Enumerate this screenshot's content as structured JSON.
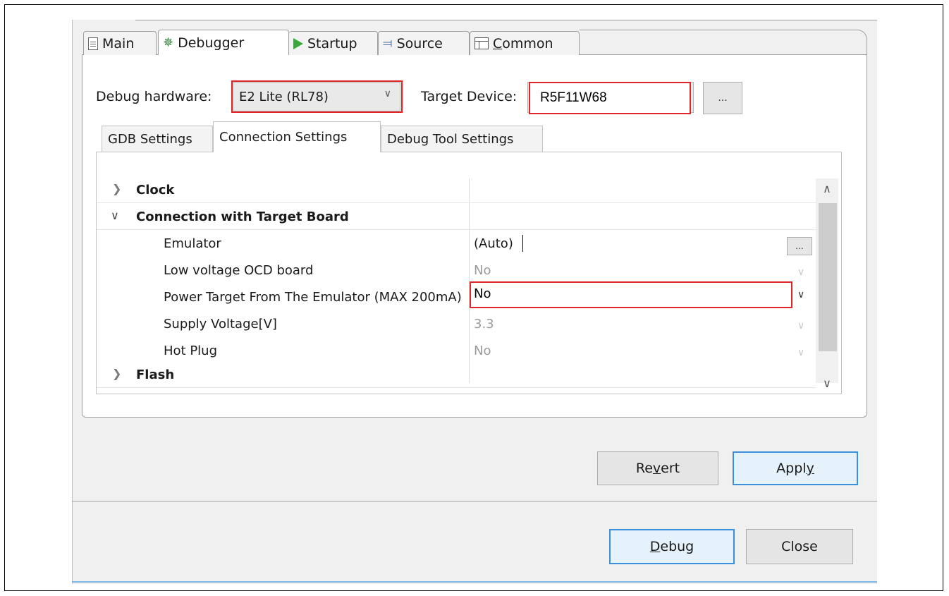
{
  "main_tabs": [
    {
      "label_pre": "Main",
      "label_u": "",
      "label_post": "",
      "icon": "document-icon",
      "active": false
    },
    {
      "label_pre": "Debugger",
      "label_u": "",
      "label_post": "",
      "icon": "bug-icon",
      "active": true
    },
    {
      "label_pre": "Startup",
      "label_u": "",
      "label_post": "",
      "icon": "play-icon",
      "active": false
    },
    {
      "label_pre": "Source",
      "label_u": "",
      "label_post": "",
      "icon": "source-icon",
      "active": false
    },
    {
      "label_pre": "",
      "label_u": "C",
      "label_post": "ommon",
      "icon": "table-icon",
      "active": false
    }
  ],
  "debug_hardware": {
    "label": "Debug hardware:",
    "value": "E2 Lite (RL78)"
  },
  "target_device": {
    "label": "Target Device:",
    "value": "R5F11W68",
    "browse_label": "..."
  },
  "sub_tabs": [
    {
      "label": "GDB Settings",
      "active": false
    },
    {
      "label": "Connection Settings",
      "active": true
    },
    {
      "label": "Debug Tool Settings",
      "active": false
    }
  ],
  "tree": {
    "clock": {
      "name": "Clock",
      "expanded": false
    },
    "connection": {
      "name": "Connection with Target Board",
      "expanded": true
    },
    "emulator": {
      "name": "Emulator",
      "value": "(Auto)",
      "button": "..."
    },
    "low_voltage": {
      "name": "Low voltage OCD board",
      "value": "No"
    },
    "power_target": {
      "name": "Power Target From The Emulator (MAX 200mA)",
      "value": "No"
    },
    "supply_voltage": {
      "name": "Supply Voltage[V]",
      "value": "3.3"
    },
    "hot_plug": {
      "name": "Hot Plug",
      "value": "No"
    },
    "flash": {
      "name": "Flash",
      "expanded": false
    }
  },
  "buttons": {
    "revert": {
      "pre": "Re",
      "u": "v",
      "post": "ert"
    },
    "apply": {
      "pre": "Appl",
      "u": "y",
      "post": ""
    },
    "debug": {
      "pre": "",
      "u": "D",
      "post": "ebug"
    },
    "close": {
      "pre": "Close",
      "u": "",
      "post": ""
    }
  },
  "colors": {
    "highlight": "#e0252b",
    "focus": "#3a8fd6"
  }
}
